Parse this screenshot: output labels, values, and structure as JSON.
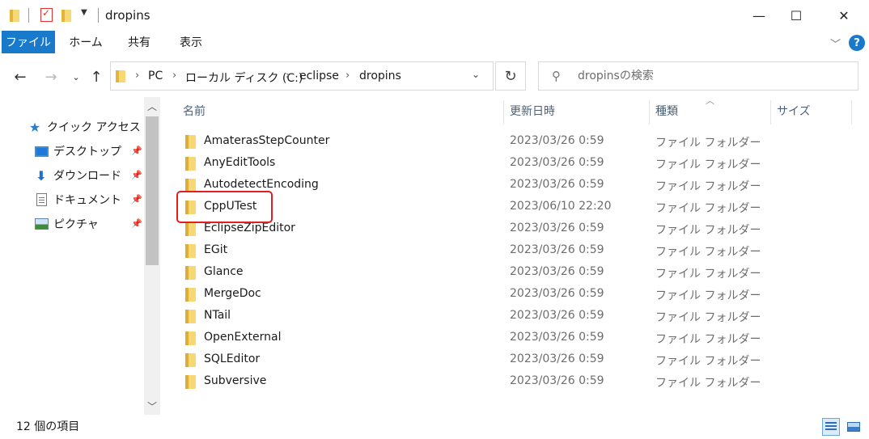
{
  "window": {
    "title": "dropins",
    "minimize_glyph": "—",
    "maximize_glyph": "☐",
    "close_glyph": "✕"
  },
  "ribbon": {
    "tabs": [
      {
        "label": "ファイル",
        "active": true
      },
      {
        "label": "ホーム"
      },
      {
        "label": "共有"
      },
      {
        "label": "表示"
      }
    ],
    "help_glyph": "?"
  },
  "address": {
    "crumbs": [
      "PC",
      "ローカル ディスク (C:)",
      "eclipse",
      "dropins"
    ]
  },
  "search": {
    "placeholder": "dropinsの検索"
  },
  "nav": {
    "quick_access": "クイック アクセス",
    "items": [
      {
        "label": "デスクトップ",
        "icon": "desktop-icon"
      },
      {
        "label": "ダウンロード",
        "icon": "download-icon"
      },
      {
        "label": "ドキュメント",
        "icon": "document-icon"
      },
      {
        "label": "ピクチャ",
        "icon": "picture-icon"
      }
    ]
  },
  "columns": {
    "name": "名前",
    "date": "更新日時",
    "type": "種類",
    "size": "サイズ"
  },
  "files": [
    {
      "name": "AmaterasStepCounter",
      "date": "2023/03/26 0:59",
      "type": "ファイル フォルダー"
    },
    {
      "name": "AnyEditTools",
      "date": "2023/03/26 0:59",
      "type": "ファイル フォルダー"
    },
    {
      "name": "AutodetectEncoding",
      "date": "2023/03/26 0:59",
      "type": "ファイル フォルダー"
    },
    {
      "name": "CppUTest",
      "date": "2023/06/10 22:20",
      "type": "ファイル フォルダー",
      "highlighted": true
    },
    {
      "name": "EclipseZipEditor",
      "date": "2023/03/26 0:59",
      "type": "ファイル フォルダー"
    },
    {
      "name": "EGit",
      "date": "2023/03/26 0:59",
      "type": "ファイル フォルダー"
    },
    {
      "name": "Glance",
      "date": "2023/03/26 0:59",
      "type": "ファイル フォルダー"
    },
    {
      "name": "MergeDoc",
      "date": "2023/03/26 0:59",
      "type": "ファイル フォルダー"
    },
    {
      "name": "NTail",
      "date": "2023/03/26 0:59",
      "type": "ファイル フォルダー"
    },
    {
      "name": "OpenExternal",
      "date": "2023/03/26 0:59",
      "type": "ファイル フォルダー"
    },
    {
      "name": "SQLEditor",
      "date": "2023/03/26 0:59",
      "type": "ファイル フォルダー"
    },
    {
      "name": "Subversive",
      "date": "2023/03/26 0:59",
      "type": "ファイル フォルダー"
    }
  ],
  "status": {
    "item_count": "12 個の項目"
  },
  "colors": {
    "accent": "#1979ca",
    "folder": "#f8d775",
    "highlight_box": "#e02020"
  }
}
